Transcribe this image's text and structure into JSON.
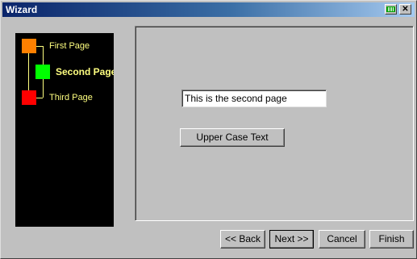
{
  "window": {
    "title": "Wizard",
    "close_glyph": "✕",
    "minimize_icon": "minimize-icon",
    "close_icon": "close-icon"
  },
  "steps": [
    {
      "label": "First Page",
      "color": "#ff8000",
      "active": false
    },
    {
      "label": "Second Page",
      "color": "#00ff00",
      "active": true
    },
    {
      "label": "Third Page",
      "color": "#ff0000",
      "active": false
    }
  ],
  "page": {
    "text_value": "This is the second page",
    "upper_case_label": "Upper Case Text"
  },
  "footer": {
    "back_label": "<< Back",
    "next_label": "Next >>",
    "cancel_label": "Cancel",
    "finish_label": "Finish"
  },
  "colors": {
    "connector": "#ffff80",
    "nav_background": "#000000",
    "window_background": "#c0c0c0"
  }
}
